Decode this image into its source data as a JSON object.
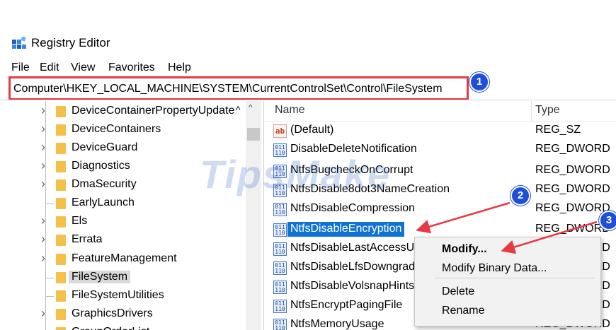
{
  "window": {
    "title": "Registry Editor",
    "icon": "registry-editor-icon"
  },
  "menu": [
    "File",
    "Edit",
    "View",
    "Favorites",
    "Help"
  ],
  "address": {
    "path": "Computer\\HKEY_LOCAL_MACHINE\\SYSTEM\\CurrentControlSet\\Control\\FileSystem"
  },
  "badges": [
    "1",
    "2",
    "3"
  ],
  "watermark": "TipsMake",
  "tree": {
    "items": [
      {
        "label": "DeviceContainerPropertyUpdate",
        "expandable": true
      },
      {
        "label": "DeviceContainers",
        "expandable": true
      },
      {
        "label": "DeviceGuard",
        "expandable": true
      },
      {
        "label": "Diagnostics",
        "expandable": true
      },
      {
        "label": "DmaSecurity",
        "expandable": true
      },
      {
        "label": "EarlyLaunch",
        "expandable": false
      },
      {
        "label": "Els",
        "expandable": true
      },
      {
        "label": "Errata",
        "expandable": true
      },
      {
        "label": "FeatureManagement",
        "expandable": true
      },
      {
        "label": "FileSystem",
        "expandable": false,
        "selected": true
      },
      {
        "label": "FileSystemUtilities",
        "expandable": false
      },
      {
        "label": "GraphicsDrivers",
        "expandable": true
      },
      {
        "label": "GroupOrderList",
        "expandable": false
      }
    ]
  },
  "list": {
    "columns": {
      "name": "Name",
      "type": "Type"
    },
    "rows": [
      {
        "name": "(Default)",
        "type": "REG_SZ",
        "icon": "string-value-icon"
      },
      {
        "name": "DisableDeleteNotification",
        "type": "REG_DWORD",
        "icon": "dword-value-icon"
      },
      {
        "name": "NtfsBugcheckOnCorrupt",
        "type": "REG_DWORD",
        "icon": "dword-value-icon"
      },
      {
        "name": "NtfsDisable8dot3NameCreation",
        "type": "REG_DWORD",
        "icon": "dword-value-icon"
      },
      {
        "name": "NtfsDisableCompression",
        "type": "REG_DWORD",
        "icon": "dword-value-icon"
      },
      {
        "name": "NtfsDisableEncryption",
        "type": "REG_DWORD",
        "icon": "dword-value-icon",
        "selected": true
      },
      {
        "name": "NtfsDisableLastAccessUpdate",
        "type": "REG_DWORD",
        "icon": "dword-value-icon"
      },
      {
        "name": "NtfsDisableLfsDowngrade",
        "type": "REG_DWORD",
        "icon": "dword-value-icon"
      },
      {
        "name": "NtfsDisableVolsnapHints",
        "type": "REG_DWORD",
        "icon": "dword-value-icon"
      },
      {
        "name": "NtfsEncryptPagingFile",
        "type": "REG_DWORD",
        "icon": "dword-value-icon"
      },
      {
        "name": "NtfsMemoryUsage",
        "type": "REG_DWORD",
        "icon": "dword-value-icon"
      }
    ]
  },
  "context_menu": {
    "items": [
      {
        "label": "Modify...",
        "bold": true
      },
      {
        "label": "Modify Binary Data..."
      },
      {
        "label": "Delete"
      },
      {
        "label": "Rename"
      }
    ]
  },
  "colors": {
    "highlight_red": "#e53a44",
    "badge_blue": "#1f4fd8",
    "selection_blue": "#0f73d6"
  }
}
